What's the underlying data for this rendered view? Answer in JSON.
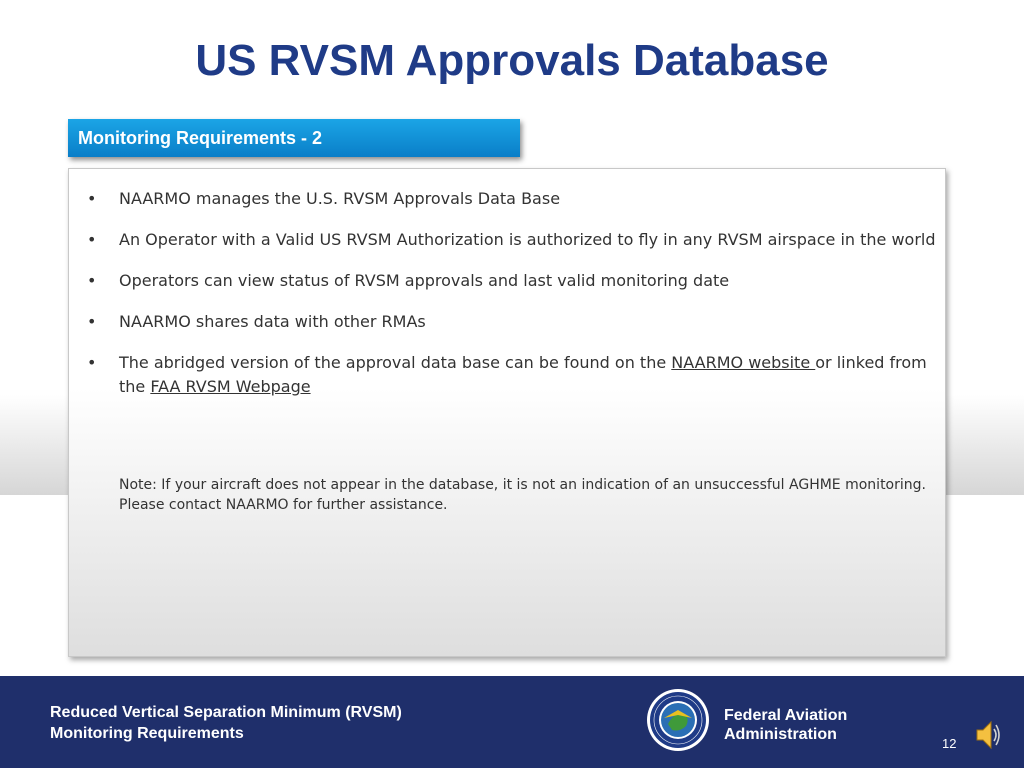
{
  "slide": {
    "title": "US RVSM Approvals Database",
    "section_heading": "Monitoring Requirements - 2",
    "bullet_glyph": "•",
    "bullets": [
      {
        "text": "NAARMO manages the U.S. RVSM Approvals Data Base"
      },
      {
        "text": "An Operator with a Valid US RVSM Authorization is authorized to fly in any RVSM airspace in the world"
      },
      {
        "text": "Operators can view status of RVSM approvals and last valid monitoring date"
      },
      {
        "text": "NAARMO shares data with other RMAs"
      },
      {
        "text_before_link1": "The abridged version of the approval data base can be found on the ",
        "link1": "NAARMO website ",
        "text_between": "or linked from the ",
        "link2": "FAA RVSM Webpage"
      }
    ],
    "note": "Note:  If your aircraft does not appear in the database, it is not an indication of an unsuccessful AGHME monitoring. Please contact NAARMO for further assistance."
  },
  "footer": {
    "line1": "Reduced Vertical Separation Minimum (RVSM)",
    "line2": "Monitoring Requirements",
    "agency_line1": "Federal Aviation",
    "agency_line2": "Administration",
    "seal_icon": "faa-seal-icon",
    "page_number": "12",
    "audio_icon": "speaker-icon"
  },
  "colors": {
    "title": "#1f3b87",
    "section_bar": "#0a7ec8",
    "footer_bg": "#1f2f6b"
  }
}
